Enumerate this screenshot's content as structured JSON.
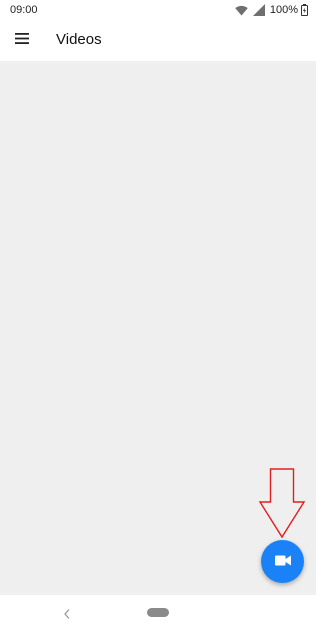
{
  "status_bar": {
    "time": "09:00",
    "battery_percent": "100%",
    "icons": [
      "wifi-icon",
      "signal-icon",
      "battery-icon"
    ]
  },
  "app_bar": {
    "title": "Videos",
    "menu_icon": "hamburger-menu-icon"
  },
  "fab": {
    "icon": "videocam-icon",
    "color": "#1a82f6"
  },
  "annotation": {
    "icon": "down-arrow-icon",
    "color": "#e02020"
  },
  "nav_bar": {
    "icons": [
      "back-icon",
      "home-pill-icon"
    ]
  },
  "colors": {
    "content_background": "#efefef",
    "fab": "#1a82f6"
  }
}
